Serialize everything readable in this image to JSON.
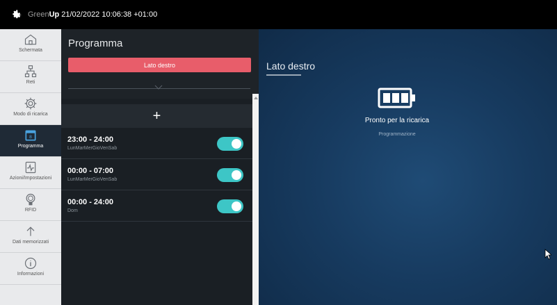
{
  "topbar": {
    "brand_prefix": "Green",
    "brand_bold": "Up",
    "datetime": "21/02/2022 10:06:38 +01:00",
    "icon": "gear-icon"
  },
  "sidebar": {
    "items": [
      {
        "label": "Schermata",
        "icon": "home-icon",
        "active": false
      },
      {
        "label": "Reti",
        "icon": "network-icon",
        "active": false
      },
      {
        "label": "Modo di ricarica",
        "icon": "settings-icon",
        "active": false
      },
      {
        "label": "Programma",
        "icon": "calendar-icon",
        "active": true
      },
      {
        "label": "Azioni/Impostazioni",
        "icon": "activity-icon",
        "active": false
      },
      {
        "label": "RFID",
        "icon": "rfid-icon",
        "active": false
      },
      {
        "label": "Dati memorizzati",
        "icon": "upload-icon",
        "active": false
      },
      {
        "label": "Informazioni",
        "icon": "info-icon",
        "active": false
      }
    ]
  },
  "panel": {
    "title": "Programma",
    "side_button": "Lato destro",
    "add_label": "+",
    "schedules": [
      {
        "time": "23:00 - 24:00",
        "days": "LunMarMerGioVenSab",
        "enabled": true
      },
      {
        "time": "00:00 - 07:00",
        "days": "LunMarMerGioVenSab",
        "enabled": true
      },
      {
        "time": "00:00 - 24:00",
        "days": "Dom",
        "enabled": true
      }
    ]
  },
  "main": {
    "title": "Lato destro",
    "status": "Pronto per la ricarica",
    "substatus": "Programmazione",
    "battery_icon": "battery-full-icon"
  },
  "colors": {
    "accent_red": "#e85d6a",
    "toggle_on": "#3dc6c6",
    "main_bg": "#173b60",
    "panel_bg": "#1e2328"
  }
}
